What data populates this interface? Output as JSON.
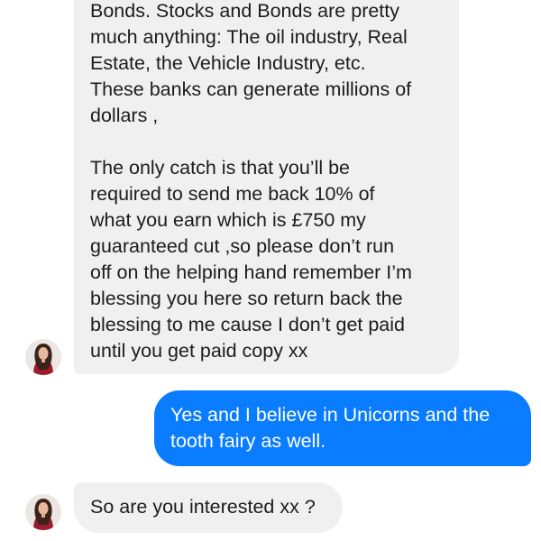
{
  "messages": [
    {
      "sender": "contact",
      "text": "Bonds. Stocks and Bonds are pretty\nmuch anything: The oil industry, Real\nEstate, the Vehicle Industry, etc.\nThese banks can generate millions of\ndollars ,\n\nThe only catch is that you’ll be\nrequired to send me back 10% of\nwhat you earn which is £750 my\nguaranteed cut ,so please don’t run\noff on the helping hand remember I’m\nblessing you here so return back the\nblessing to me cause I don’t get paid\nuntil you get paid copy xx"
    },
    {
      "sender": "me",
      "text": "Yes and I believe in Unicorns and the\ntooth fairy as well."
    },
    {
      "sender": "contact",
      "text": "So are you interested xx ?"
    }
  ],
  "colors": {
    "incoming_bubble": "#f0f0f0",
    "outgoing_bubble": "#0a7cff",
    "incoming_text": "#1c1c1c",
    "outgoing_text": "#ffffff"
  },
  "avatar": {
    "icon": "contact-avatar-photo"
  }
}
